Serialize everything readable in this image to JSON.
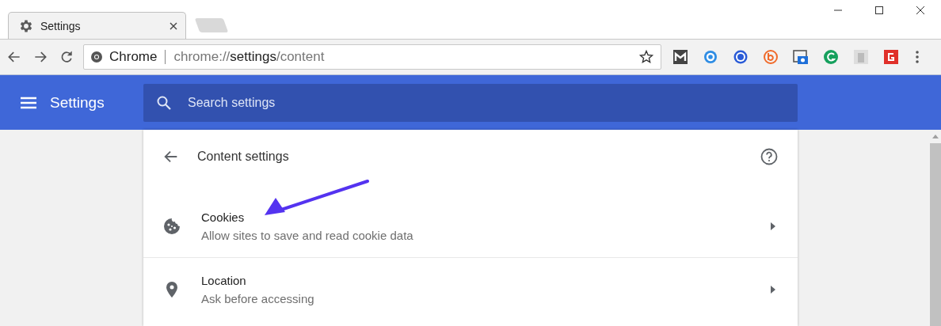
{
  "tab": {
    "title": "Settings",
    "selected": true
  },
  "omnibox": {
    "site": "Chrome",
    "url": {
      "scheme": "chrome://",
      "host": "settings",
      "path": "/content"
    }
  },
  "header": {
    "title": "Settings",
    "search": {
      "placeholder": "Search settings"
    }
  },
  "page": {
    "title": "Content settings",
    "items": [
      {
        "kind": "cookie",
        "title": "Cookies",
        "subtitle": "Allow sites to save and read cookie data"
      },
      {
        "kind": "location",
        "title": "Location",
        "subtitle": "Ask before accessing"
      }
    ]
  }
}
